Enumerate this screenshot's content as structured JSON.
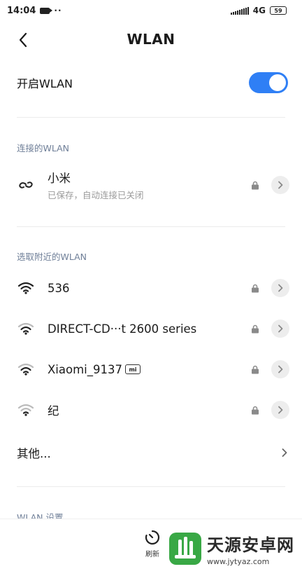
{
  "status_bar": {
    "time": "14:04",
    "network": "4G",
    "battery": "59"
  },
  "header": {
    "title": "WLAN"
  },
  "wlan_toggle": {
    "label": "开启WLAN",
    "enabled": true
  },
  "connected": {
    "section_title": "连接的WLAN",
    "item": {
      "name": "小米",
      "status": "已保存，自动连接已关闭",
      "icon": "link-icon"
    }
  },
  "nearby": {
    "section_title": "选取附近的WLAN",
    "items": [
      {
        "name": "536",
        "icon": "wifi-icon",
        "locked": true
      },
      {
        "name": "DIRECT-CD···t 2600 series",
        "icon": "wifi-icon",
        "locked": true
      },
      {
        "name": "Xiaomi_9137",
        "badge": "mi",
        "icon": "wifi-icon",
        "locked": true
      },
      {
        "name": "纪",
        "icon": "wifi-icon",
        "locked": true
      }
    ]
  },
  "other": {
    "label": "其他..."
  },
  "settings": {
    "section_title": "WLAN 设置"
  },
  "bottom": {
    "refresh_label": "刷新"
  },
  "watermark": {
    "title": "天源安卓网",
    "url": "www.jytyaz.com"
  },
  "colors": {
    "accent": "#2f7ff5",
    "section": "#6f7f98",
    "watermark_green": "#39a845"
  }
}
